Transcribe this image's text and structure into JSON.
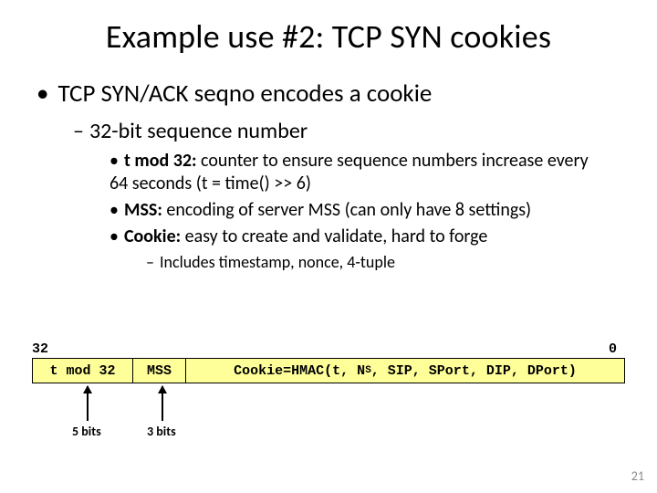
{
  "title": "Example use #2:  TCP SYN cookies",
  "l1": "TCP SYN/ACK seqno encodes a cookie",
  "l2": "32-bit sequence number",
  "l3a_b": "t mod 32:",
  "l3a": " counter to ensure sequence numbers increase every 64 seconds  (t = time() >> 6)",
  "l3b_b": "MSS:",
  "l3b": " encoding of server MSS (can only have 8 settings)",
  "l3c_b": "Cookie:",
  "l3c": " easy to create and validate, hard to forge",
  "l4": "Includes timestamp, nonce, 4-tuple",
  "diagram": {
    "bit_hi": "32",
    "bit_lo": "0",
    "field_tmod": "t mod 32",
    "field_mss": "MSS",
    "cookie_pre": "Cookie=HMAC(t, N",
    "cookie_sub": "S",
    "cookie_post": ", SIP, SPort, DIP, DPort)",
    "lbl_t": "5 bits",
    "lbl_m": "3 bits"
  },
  "pagenum": "21"
}
